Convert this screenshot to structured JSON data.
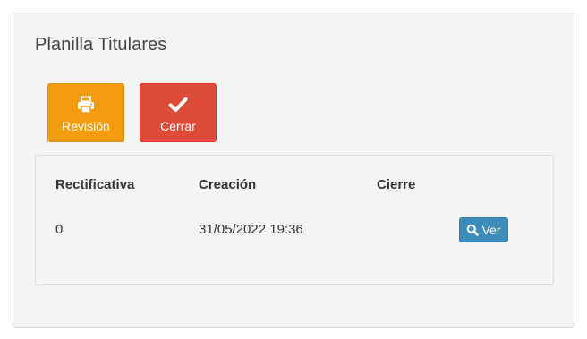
{
  "panel": {
    "title": "Planilla Titulares"
  },
  "actions": {
    "revision_label": "Revisión",
    "revision_icon": "print-icon",
    "cerrar_label": "Cerrar",
    "cerrar_icon": "check-icon",
    "revision_color": "#f39c12",
    "cerrar_color": "#dd4b39"
  },
  "table": {
    "headers": [
      "Rectificativa",
      "Creación",
      "Cierre"
    ],
    "rows": [
      {
        "rectificativa": "0",
        "creacion": "31/05/2022 19:36",
        "cierre": "",
        "action_label": "Ver",
        "action_icon": "search-icon"
      }
    ],
    "action_color": "#3c8dbc"
  }
}
